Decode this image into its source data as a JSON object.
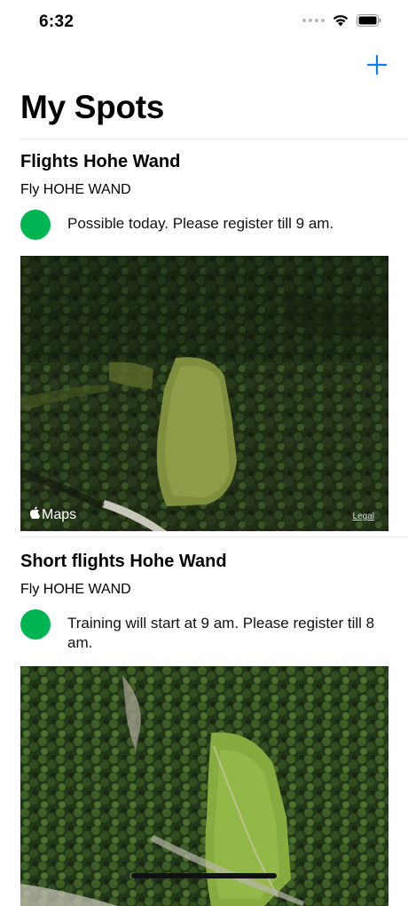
{
  "status_bar": {
    "time": "6:32"
  },
  "nav": {
    "add_icon": "plus-icon"
  },
  "page": {
    "title": "My Spots"
  },
  "spots": [
    {
      "name": "Flights Hohe Wand",
      "club": "Fly HOHE WAND",
      "status_text": "Possible today. Please register till 9 am.",
      "status_color": "#00b552",
      "map": {
        "logo_text": "Maps",
        "legal_text": "Legal"
      }
    },
    {
      "name": "Short flights Hohe Wand",
      "club": "Fly HOHE WAND",
      "status_text": "Training will start at 9 am. Please register till 8 am.",
      "status_color": "#00b552",
      "map": {
        "logo_text": "",
        "legal_text": ""
      }
    }
  ],
  "colors": {
    "accent": "#0a7aff",
    "status_ok": "#00b552"
  }
}
